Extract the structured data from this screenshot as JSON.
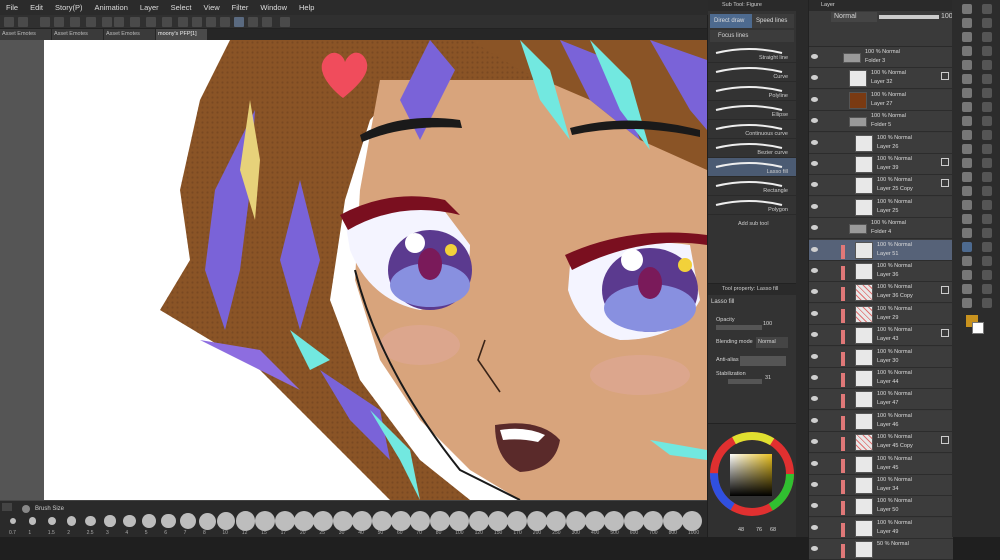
{
  "menu": [
    "File",
    "Edit",
    "Story(P)",
    "Animation",
    "Layer",
    "Select",
    "View",
    "Filter",
    "Window",
    "Help"
  ],
  "tabs": [
    "Asset Emotes",
    "Asset Emotes",
    "Asset Emotes",
    "moony's PFP[1]"
  ],
  "brushbar": {
    "title": "Brush Size",
    "sizes": [
      "0.7",
      "1",
      "1.5",
      "2",
      "2.5",
      "3",
      "4",
      "5",
      "6",
      "7",
      "8",
      "10",
      "12",
      "15",
      "17",
      "20",
      "25",
      "30",
      "40",
      "50",
      "60",
      "70",
      "80",
      "100",
      "120",
      "150",
      "170",
      "200",
      "250",
      "300",
      "400",
      "500",
      "600",
      "700",
      "800",
      "1000"
    ]
  },
  "subtool": {
    "header": "Sub Tool: Figure",
    "tabs": [
      "Direct draw",
      "Speed lines"
    ],
    "focus": "Focus lines",
    "items": [
      "Straight line",
      "Curve",
      "Polyline",
      "Ellipse",
      "Continuous curve",
      "Bezier curve",
      "Lasso fill",
      "Rectangle",
      "Polygon"
    ],
    "add": "Add sub tool"
  },
  "toolprop": {
    "header": "Tool property: Lasso fill",
    "name": "Lasso fill",
    "opacity_label": "Opacity",
    "opacity": "100",
    "blend_label": "Blending mode",
    "blend": "Normal",
    "aa_label": "Anti-alias",
    "stab_label": "Stabilization",
    "stab": "31"
  },
  "colorwheel": {
    "h": "48",
    "s": "76",
    "v": "68"
  },
  "layers": {
    "header": "Layer",
    "mode": "Normal",
    "opacity": "100",
    "rows": [
      {
        "m": "100 % Normal",
        "n": "Folder 3",
        "t": "folder",
        "x": 34
      },
      {
        "m": "100 % Normal",
        "n": "Layer 32",
        "t": "layer",
        "x": 40
      },
      {
        "m": "100 % Normal",
        "n": "Layer 27",
        "t": "brown",
        "x": 40
      },
      {
        "m": "100 % Normal",
        "n": "Folder 5",
        "t": "folder",
        "x": 40
      },
      {
        "m": "100 % Normal",
        "n": "Layer 26",
        "t": "layer",
        "x": 46
      },
      {
        "m": "100 % Normal",
        "n": "Layer 39",
        "t": "layer",
        "x": 46
      },
      {
        "m": "100 % Normal",
        "n": "Layer 25 Copy",
        "t": "layer",
        "x": 46
      },
      {
        "m": "100 % Normal",
        "n": "Layer 25",
        "t": "layer",
        "x": 46
      },
      {
        "m": "100 % Normal",
        "n": "Folder 4",
        "t": "folder",
        "x": 40
      },
      {
        "m": "100 % Normal",
        "n": "Layer 51",
        "t": "layer",
        "x": 46,
        "sel": true
      },
      {
        "m": "100 % Normal",
        "n": "Layer 36",
        "t": "layer",
        "x": 46
      },
      {
        "m": "100 % Normal",
        "n": "Layer 36 Copy",
        "t": "red",
        "x": 46
      },
      {
        "m": "100 % Normal",
        "n": "Layer 29",
        "t": "red",
        "x": 46
      },
      {
        "m": "100 % Normal",
        "n": "Layer 43",
        "t": "layer",
        "x": 46
      },
      {
        "m": "100 % Normal",
        "n": "Layer 30",
        "t": "layer",
        "x": 46
      },
      {
        "m": "100 % Normal",
        "n": "Layer 44",
        "t": "layer",
        "x": 46
      },
      {
        "m": "100 % Normal",
        "n": "Layer 47",
        "t": "layer",
        "x": 46
      },
      {
        "m": "100 % Normal",
        "n": "Layer 46",
        "t": "layer",
        "x": 46
      },
      {
        "m": "100 % Normal",
        "n": "Layer 45 Copy",
        "t": "red",
        "x": 46
      },
      {
        "m": "100 % Normal",
        "n": "Layer 45",
        "t": "layer",
        "x": 46
      },
      {
        "m": "100 % Normal",
        "n": "Layer 34",
        "t": "layer",
        "x": 46
      },
      {
        "m": "100 % Normal",
        "n": "Layer 50",
        "t": "layer",
        "x": 46
      },
      {
        "m": "100 % Normal",
        "n": "Layer 49",
        "t": "layer",
        "x": 46
      },
      {
        "m": "50 % Normal",
        "n": "",
        "t": "layer",
        "x": 46
      }
    ]
  },
  "colors": {
    "main": "#c8921e",
    "sub": "#ffffff",
    "accent": "#4d6a8f"
  }
}
